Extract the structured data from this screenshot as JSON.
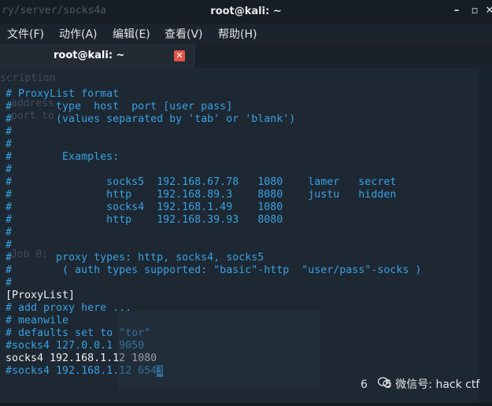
{
  "window": {
    "ghost_path": "ry/server/socks4a",
    "title": "root@kali: ~",
    "controls": {
      "minimize": "–",
      "maximize": "▫",
      "close": "✕"
    }
  },
  "menu": [
    "文件(F)",
    "动作(A)",
    "编辑(E)",
    "查看(V)",
    "帮助(H)"
  ],
  "tab": {
    "label": "root@kali: ~",
    "close": "✕"
  },
  "ghost_text": [
    "scription",
    "address",
    "port to",
    "Job 0:"
  ],
  "lines": [
    {
      "text": "# ProxyList format",
      "color": "blue"
    },
    {
      "text": "#       type  host  port [user pass]",
      "color": "blue"
    },
    {
      "text": "#       (values separated by 'tab' or 'blank')",
      "color": "blue"
    },
    {
      "text": "#",
      "color": "blue"
    },
    {
      "text": "#",
      "color": "blue"
    },
    {
      "text": "#        Examples:",
      "color": "blue"
    },
    {
      "text": "#",
      "color": "blue"
    },
    {
      "text": "#               socks5  192.168.67.78   1080    lamer   secret",
      "color": "blue"
    },
    {
      "text": "#               http    192.168.89.3    8080    justu   hidden",
      "color": "blue"
    },
    {
      "text": "#               socks4  192.168.1.49    1080",
      "color": "blue"
    },
    {
      "text": "#               http    192.168.39.93   8080",
      "color": "blue"
    },
    {
      "text": "#",
      "color": "blue"
    },
    {
      "text": "#",
      "color": "blue"
    },
    {
      "text": "#       proxy types: http, socks4, socks5",
      "color": "blue"
    },
    {
      "text": "#        ( auth types supported: \"basic\"-http  \"user/pass\"-socks )",
      "color": "blue"
    },
    {
      "text": "#",
      "color": "blue"
    },
    {
      "text": "[ProxyList]",
      "color": "white"
    },
    {
      "text": "# add proxy here ...",
      "color": "blue"
    },
    {
      "text": "# meanwile",
      "color": "blue"
    },
    {
      "text": "# defaults set to \"tor\"",
      "color": "blue"
    },
    {
      "text": "#socks4 127.0.0.1 9050",
      "color": "blue"
    },
    {
      "text": "socks4 192.168.1.12 1080",
      "color": "white"
    },
    {
      "text": "#socks4 192.168.1.12 654",
      "color": "blue"
    }
  ],
  "cursor_char": "3",
  "watermark": {
    "left": "6",
    "right": "5 微信号: hack ctf"
  }
}
